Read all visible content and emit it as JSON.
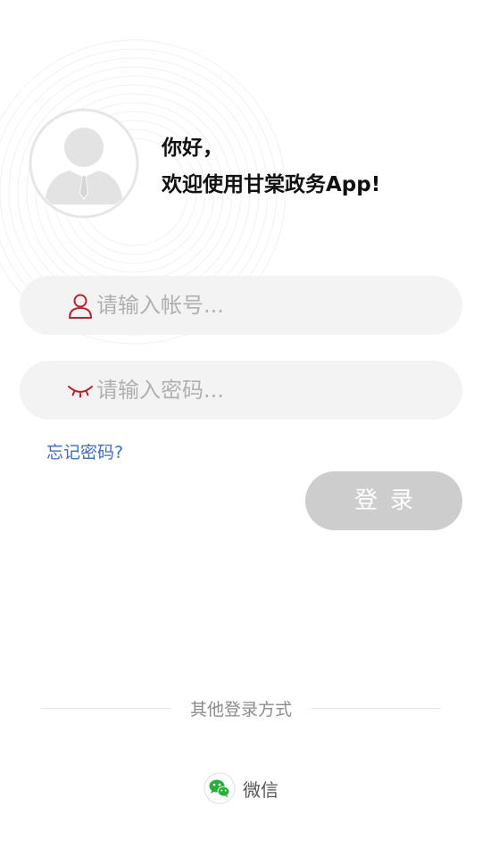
{
  "greeting": {
    "line1": "你好，",
    "line2": "欢迎使用甘棠政务App!"
  },
  "account": {
    "placeholder": "请输入帐号...",
    "value": "",
    "icon": "user-icon"
  },
  "password": {
    "placeholder": "请输入密码...",
    "value": "",
    "icon": "closed-eye-icon"
  },
  "forgot_label": "忘记密码?",
  "login_label": "登录",
  "other_login": {
    "title": "其他登录方式",
    "wechat_label": "微信",
    "wechat_icon": "wechat-icon"
  },
  "colors": {
    "accent": "#b5232e",
    "link": "#3f6db8",
    "button_disabled": "#cdcdcd",
    "field_bg": "#f3f3f3",
    "wechat_green": "#2aae3a"
  }
}
